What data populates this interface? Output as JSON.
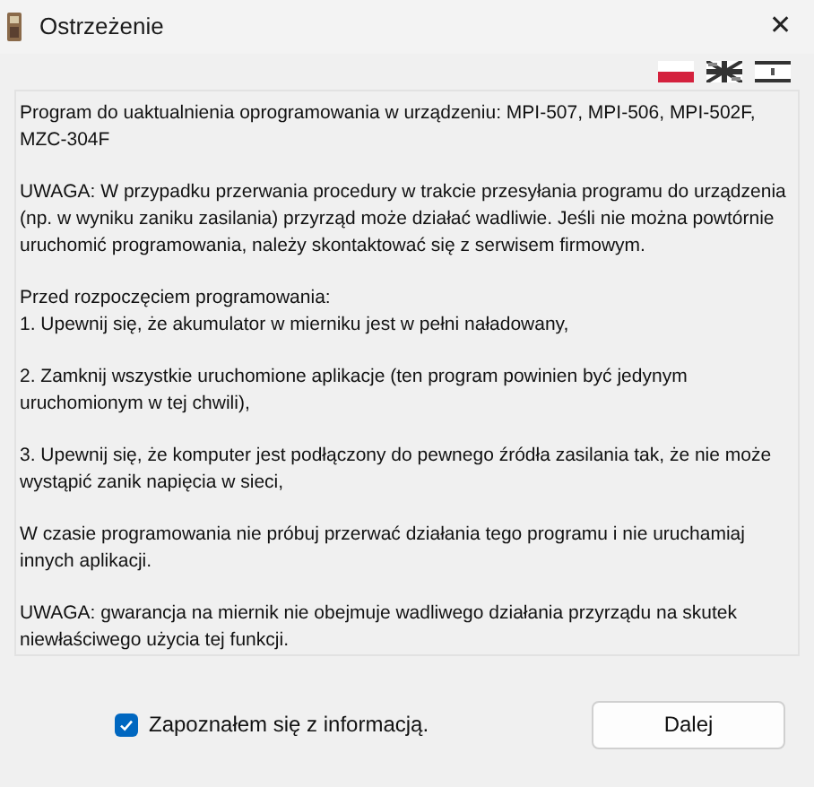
{
  "window": {
    "title": "Ostrzeżenie",
    "close": "✕"
  },
  "languages": [
    {
      "kind": "pl"
    },
    {
      "kind": "en"
    },
    {
      "kind": "other"
    }
  ],
  "message": [
    "Program do uaktualnienia oprogramowania w urządzeniu: MPI-507, MPI-506, MPI-502F, MZC-304F",
    "UWAGA: W przypadku przerwania procedury w trakcie przesyłania programu do urządzenia (np. w wyniku zaniku zasilania) przyrząd może działać wadliwie. Jeśli nie można powtórnie uruchomić programowania, należy skontaktować się z serwisem firmowym.",
    "Przed rozpoczęciem programowania:\n1. Upewnij się, że akumulator w mierniku jest w pełni naładowany,",
    "2. Zamknij wszystkie uruchomione aplikacje (ten program powinien być jedynym uruchomionym w tej chwili),",
    "3. Upewnij się, że komputer jest podłączony do pewnego źródła zasilania tak, że nie może wystąpić zanik napięcia w sieci,",
    "W czasie programowania nie próbuj przerwać działania tego programu i nie uruchamiaj innych aplikacji.",
    "UWAGA: gwarancja na miernik nie obejmuje wadliwego działania przyrządu na skutek niewłaściwego użycia tej funkcji."
  ],
  "acknowledge": {
    "label": "Zapoznałem się z informacją.",
    "checked": true
  },
  "button": "Dalej"
}
